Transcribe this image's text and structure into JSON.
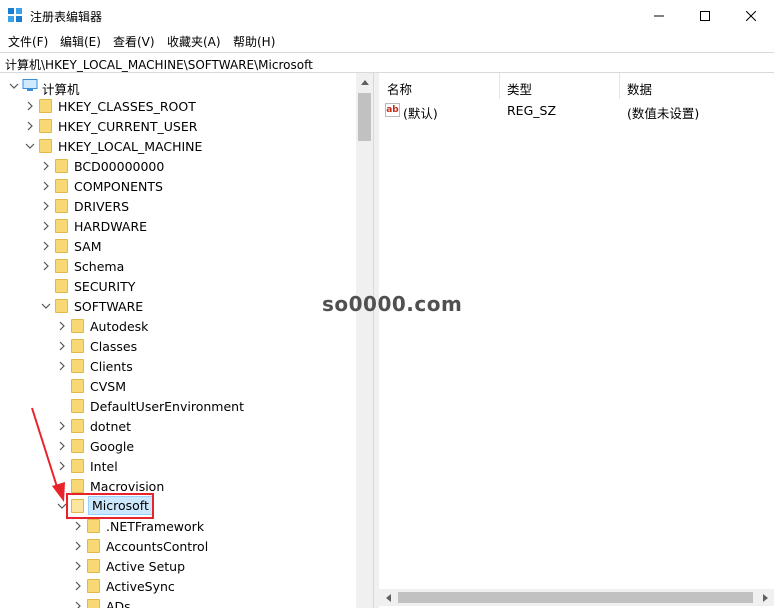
{
  "window": {
    "title": "注册表编辑器",
    "minimize_icon": "minimize-icon",
    "maximize_icon": "maximize-icon",
    "close_icon": "close-icon"
  },
  "menu": [
    "文件(F)",
    "编辑(E)",
    "查看(V)",
    "收藏夹(A)",
    "帮助(H)"
  ],
  "address": "计算机\\HKEY_LOCAL_MACHINE\\SOFTWARE\\Microsoft",
  "tree": {
    "root": "计算机",
    "nodes": [
      {
        "label": "HKEY_CLASSES_ROOT",
        "expanded": false
      },
      {
        "label": "HKEY_CURRENT_USER",
        "expanded": false
      },
      {
        "label": "HKEY_LOCAL_MACHINE",
        "expanded": true
      },
      {
        "label": "BCD00000000",
        "expanded": false
      },
      {
        "label": "COMPONENTS",
        "expanded": false
      },
      {
        "label": "DRIVERS",
        "expanded": false
      },
      {
        "label": "HARDWARE",
        "expanded": false
      },
      {
        "label": "SAM",
        "expanded": false
      },
      {
        "label": "Schema",
        "expanded": false
      },
      {
        "label": "SECURITY",
        "expanded": false
      },
      {
        "label": "SOFTWARE",
        "expanded": true
      },
      {
        "label": "Autodesk",
        "expanded": false
      },
      {
        "label": "Classes",
        "expanded": false
      },
      {
        "label": "Clients",
        "expanded": false
      },
      {
        "label": "CVSM",
        "expanded": false
      },
      {
        "label": "DefaultUserEnvironment",
        "expanded": false
      },
      {
        "label": "dotnet",
        "expanded": false
      },
      {
        "label": "Google",
        "expanded": false
      },
      {
        "label": "Intel",
        "expanded": false
      },
      {
        "label": "Macrovision",
        "expanded": false
      },
      {
        "label": "Microsoft",
        "expanded": true,
        "selected": true
      },
      {
        "label": ".NETFramework",
        "expanded": false
      },
      {
        "label": "AccountsControl",
        "expanded": false
      },
      {
        "label": "Active Setup",
        "expanded": false
      },
      {
        "label": "ActiveSync",
        "expanded": false
      },
      {
        "label": "ADs",
        "expanded": false
      }
    ]
  },
  "list": {
    "columns": [
      "名称",
      "类型",
      "数据"
    ],
    "rows": [
      {
        "icon": "ab",
        "name": "(默认)",
        "type": "REG_SZ",
        "data": "(数值未设置)"
      }
    ]
  },
  "watermark": "so0000.com",
  "colors": {
    "selection_bg": "#cce8ff",
    "folder": "#f8d775",
    "highlight": "#e8232b"
  }
}
